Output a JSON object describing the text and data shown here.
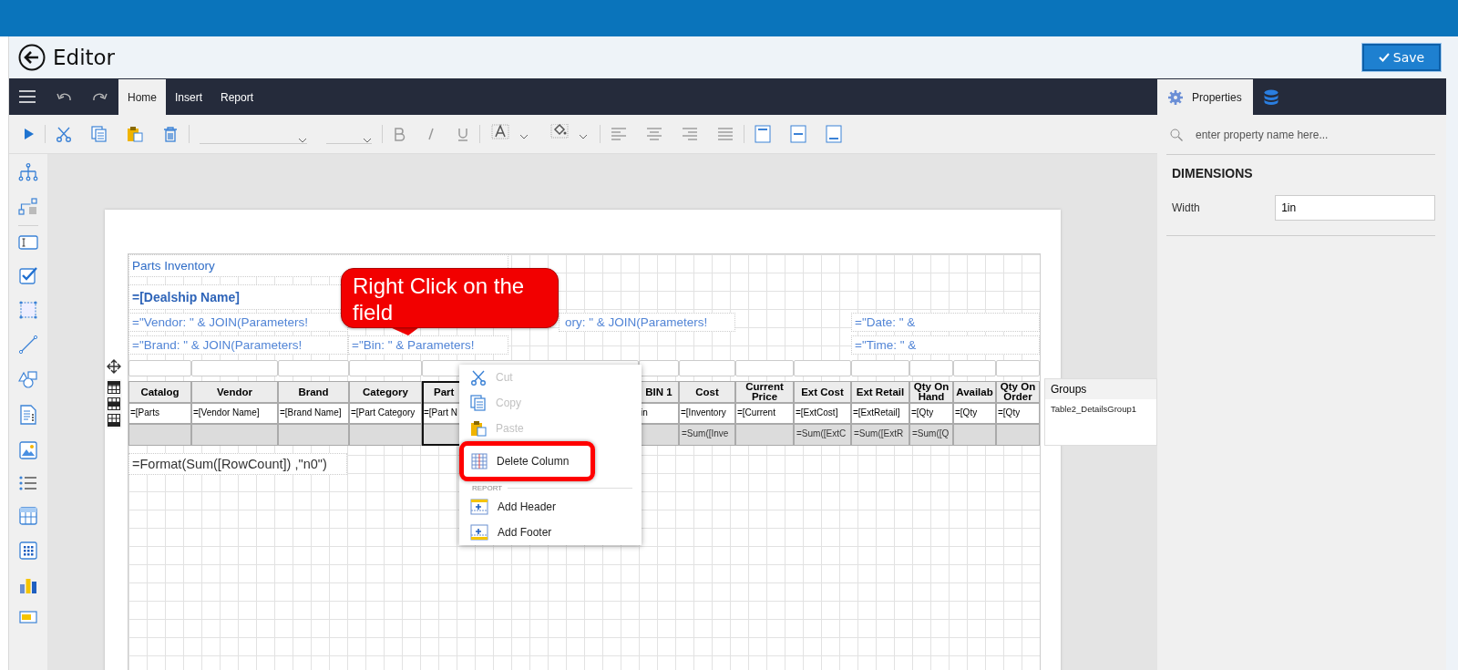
{
  "window": {
    "title": "Editor",
    "save_label": "Save"
  },
  "toolbar": {
    "tabs": [
      {
        "label": "Home",
        "selected": true
      },
      {
        "label": "Insert",
        "selected": false
      },
      {
        "label": "Report",
        "selected": false
      }
    ]
  },
  "report": {
    "header_items": [
      {
        "kind": "title",
        "text": "Parts Inventory"
      },
      {
        "kind": "heading",
        "text": "=[Dealship Name]"
      },
      {
        "kind": "expression",
        "text": "=\"Vendor: \" & JOIN(Parameters!"
      },
      {
        "kind": "expression",
        "text": "ory: \" & JOIN(Parameters!"
      },
      {
        "kind": "expression",
        "text": "=\"Date: \" &"
      },
      {
        "kind": "expression",
        "text": "=\"Brand: \" & JOIN(Parameters!"
      },
      {
        "kind": "expression",
        "text": "=\"Bin: \" & Parameters!"
      },
      {
        "kind": "expression",
        "text": "=\"Time: \" &"
      }
    ],
    "table": {
      "columns": [
        {
          "header": "Catalog",
          "detail": "=[Parts",
          "selected": false
        },
        {
          "header": "Vendor",
          "detail": "=[Vendor Name]",
          "selected": false
        },
        {
          "header": "Brand",
          "detail": "=[Brand Name]",
          "selected": false
        },
        {
          "header": "Category",
          "detail": "=[Part Category",
          "selected": false
        },
        {
          "header": "Part",
          "detail": "=[Part N",
          "selected": true
        },
        {
          "header": "BIN 1",
          "detail": "in",
          "selected": false
        },
        {
          "header": "Cost",
          "detail": "=[Inventory",
          "footer": "=Sum([Inve",
          "selected": false
        },
        {
          "header": "Current Price",
          "detail": "=[Current",
          "selected": false
        },
        {
          "header": "Ext Cost",
          "detail": "=[ExtCost]",
          "footer": "=Sum([ExtC",
          "selected": false
        },
        {
          "header": "Ext Retail",
          "detail": "=[ExtRetail]",
          "footer": "=Sum([ExtR",
          "selected": false
        },
        {
          "header": "Qty On Hand",
          "detail": "=[Qty",
          "footer": "=Sum([Q",
          "selected": false
        },
        {
          "header": "Availab",
          "detail": "=[Qty",
          "selected": false
        },
        {
          "header": "Qty On Order",
          "detail": "=[Qty",
          "selected": false
        }
      ]
    },
    "footer_text": "=Format(Sum([RowCount]) ,\"n0\")"
  },
  "callout": {
    "text": "Right Click on the field"
  },
  "context_menu": {
    "items": [
      {
        "kind": "item",
        "label": "Cut",
        "disabled": true,
        "annotated": false
      },
      {
        "kind": "item",
        "label": "Copy",
        "disabled": true,
        "annotated": false
      },
      {
        "kind": "item",
        "label": "Paste",
        "disabled": true,
        "annotated": false
      },
      {
        "kind": "item",
        "label": "Delete Column",
        "disabled": false,
        "annotated": true
      },
      {
        "kind": "section",
        "label": "REPORT"
      },
      {
        "kind": "item",
        "label": "Add Header",
        "disabled": false,
        "annotated": false
      },
      {
        "kind": "item",
        "label": "Add Footer",
        "disabled": false,
        "annotated": false
      }
    ]
  },
  "groups": {
    "title": "Groups",
    "items": [
      "Table2_DetailsGroup1"
    ]
  },
  "properties": {
    "tabs": [
      {
        "kind": "text",
        "label": "Properties",
        "selected": true
      },
      {
        "kind": "icon",
        "selected": false
      }
    ],
    "search": {
      "placeholder": "enter property name here..."
    },
    "sections": [
      {
        "title": "DIMENSIONS",
        "fields": [
          {
            "label": "Width",
            "value": "1in"
          }
        ]
      }
    ]
  }
}
